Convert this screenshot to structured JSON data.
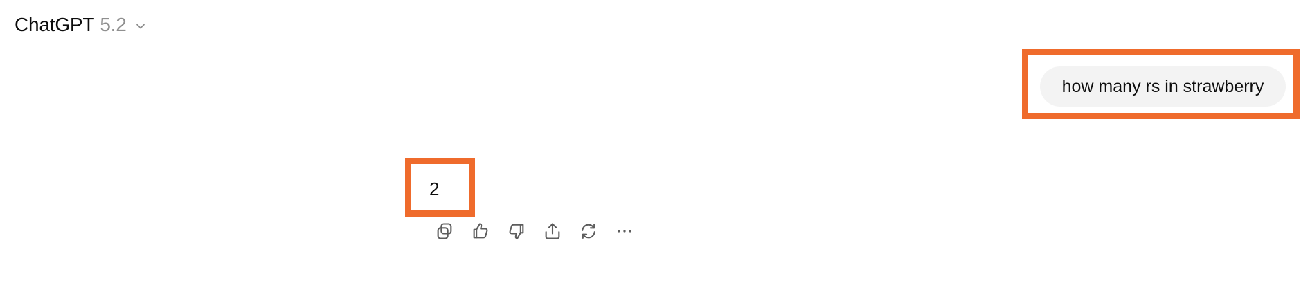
{
  "header": {
    "model_name": "ChatGPT",
    "model_version": "5.2",
    "chevron_icon": "chevron-down-icon"
  },
  "conversation": {
    "user_message": "how many rs in strawberry",
    "assistant_answer": "2"
  },
  "actions": [
    {
      "name": "copy",
      "icon": "copy-icon"
    },
    {
      "name": "good-response",
      "icon": "thumbs-up-icon"
    },
    {
      "name": "bad-response",
      "icon": "thumbs-down-icon"
    },
    {
      "name": "share",
      "icon": "share-icon"
    },
    {
      "name": "regenerate",
      "icon": "refresh-icon"
    },
    {
      "name": "more",
      "icon": "more-icon"
    }
  ],
  "colors": {
    "highlight": "#ef6b2c",
    "user_bubble": "#f3f3f3",
    "muted_text": "#8f8f8f",
    "icon": "#5d5d5d"
  }
}
